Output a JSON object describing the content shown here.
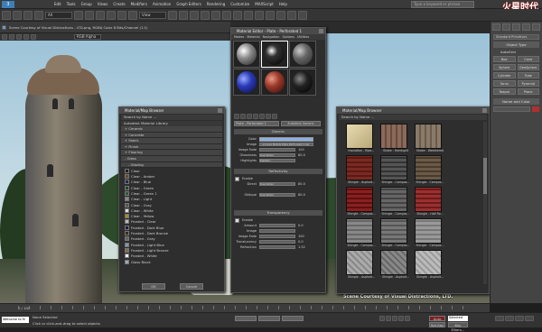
{
  "menubar": {
    "items": [
      "Edit",
      "Tools",
      "Group",
      "Views",
      "Create",
      "Modifiers",
      "Animation",
      "Graph Editors",
      "Rendering",
      "Customize",
      "MAXScript",
      "Help"
    ],
    "search_placeholder": "Type a keyword or phrase"
  },
  "toolbar": {
    "selection_filter": "All",
    "view_select": "View"
  },
  "viewport": {
    "title": "Scene Courtesy of Visual Distractions - LTD.png, RGBA Color 8 Bits/Channel (1:1)",
    "channel": "RGB Alpha",
    "credit": "Scene Courtesy of Visual Distractions, LTD."
  },
  "command_panel": {
    "dropdown": "Standard Primitives",
    "object_type": "Object Type",
    "autogrid": "AutoGrid",
    "buttons": [
      "Box",
      "Cone",
      "Sphere",
      "GeoSphere",
      "Cylinder",
      "Tube",
      "Torus",
      "Pyramid",
      "Teapot",
      "Plane"
    ],
    "name_color": "Name and Color"
  },
  "browser": {
    "title": "Material/Map Browser",
    "search": "Search by Name ...",
    "library": "Autodesk Material Library",
    "categories": [
      "Ceramic",
      "Concrete",
      "Fabric",
      "Finish",
      "Flooring",
      "Glass",
      "Glazing"
    ],
    "materials": [
      "Clear",
      "Clear - Amber",
      "Clear - Blue",
      "Clear - Green",
      "Clear - Green 1",
      "Clear - Light",
      "Clear - Gray",
      "Clear - White",
      "Clear - Yellow",
      "Frosted - Clear",
      "Frosted - Dark Blue",
      "Frosted - Dark Bronze",
      "Frosted - Gray",
      "Frosted - Light Blue",
      "Frosted - Light Bronze",
      "Frosted - White",
      "Glass Block"
    ],
    "ok": "OK",
    "cancel": "Cancel"
  },
  "editor": {
    "title": "Material Editor - Plate - Perforated 1",
    "menu": [
      "Modes",
      "Material",
      "Navigation",
      "Options",
      "Utilities"
    ],
    "mat_name": "Plate - Perforated 1",
    "mat_type": "Autodesk Generic",
    "generic": "Generic",
    "color_label": "Color",
    "image_label": "Image",
    "image_value": "...vorweg Metals Plate Perforated 1.jpg",
    "image_fade_label": "Image Fade",
    "image_fade": "100",
    "glossiness_label": "Glossiness",
    "glossiness": "80.0",
    "highlights_label": "Highlights",
    "highlights": "Metallic",
    "reflectivity": "Reflectivity",
    "enable": "Enable",
    "direct_label": "Direct",
    "direct": "80.0",
    "oblique_label": "Oblique",
    "oblique": "80.0",
    "use_slider": "Use Slider",
    "transparency": "Transparency",
    "amount_label": "Amount",
    "amount": "0.0",
    "image_label2": "Image",
    "image_fade2": "100",
    "translucency_label": "Translucency",
    "translucency": "0.0",
    "refraction_label": "Refraction",
    "refraction": "1.52"
  },
  "browser2": {
    "title": "Material/Map Browser",
    "search": "Search by Name ...",
    "items": [
      "Insulation - Ripe...",
      "Shake - Handsplit",
      "Shake - Weathered",
      "Shingle - Asphalt...",
      "Shingle - Compos...",
      "Shingle - Compos...",
      "Shingle - Compos...",
      "Shingle - Compos...",
      "Shingle - Half Ro...",
      "Shingle - Compos...",
      "Shingle - Compos...",
      "Shingle - Compos...",
      "Shingle - Asphalt...",
      "Shingle - Asphalt...",
      "Shingle - Asphalt..."
    ]
  },
  "timeline": {
    "frame": "0 / 100"
  },
  "status": {
    "selected": "None Selected",
    "prompt": "Click or click-and-drag to select objects",
    "maxscript": "Welcome to M",
    "key": "Auto Key",
    "selected_dd": "Selected",
    "setkey": "Set Key",
    "keyfilters": "Key Filters..."
  },
  "watermark": "火星时代 www.hxsd.com"
}
